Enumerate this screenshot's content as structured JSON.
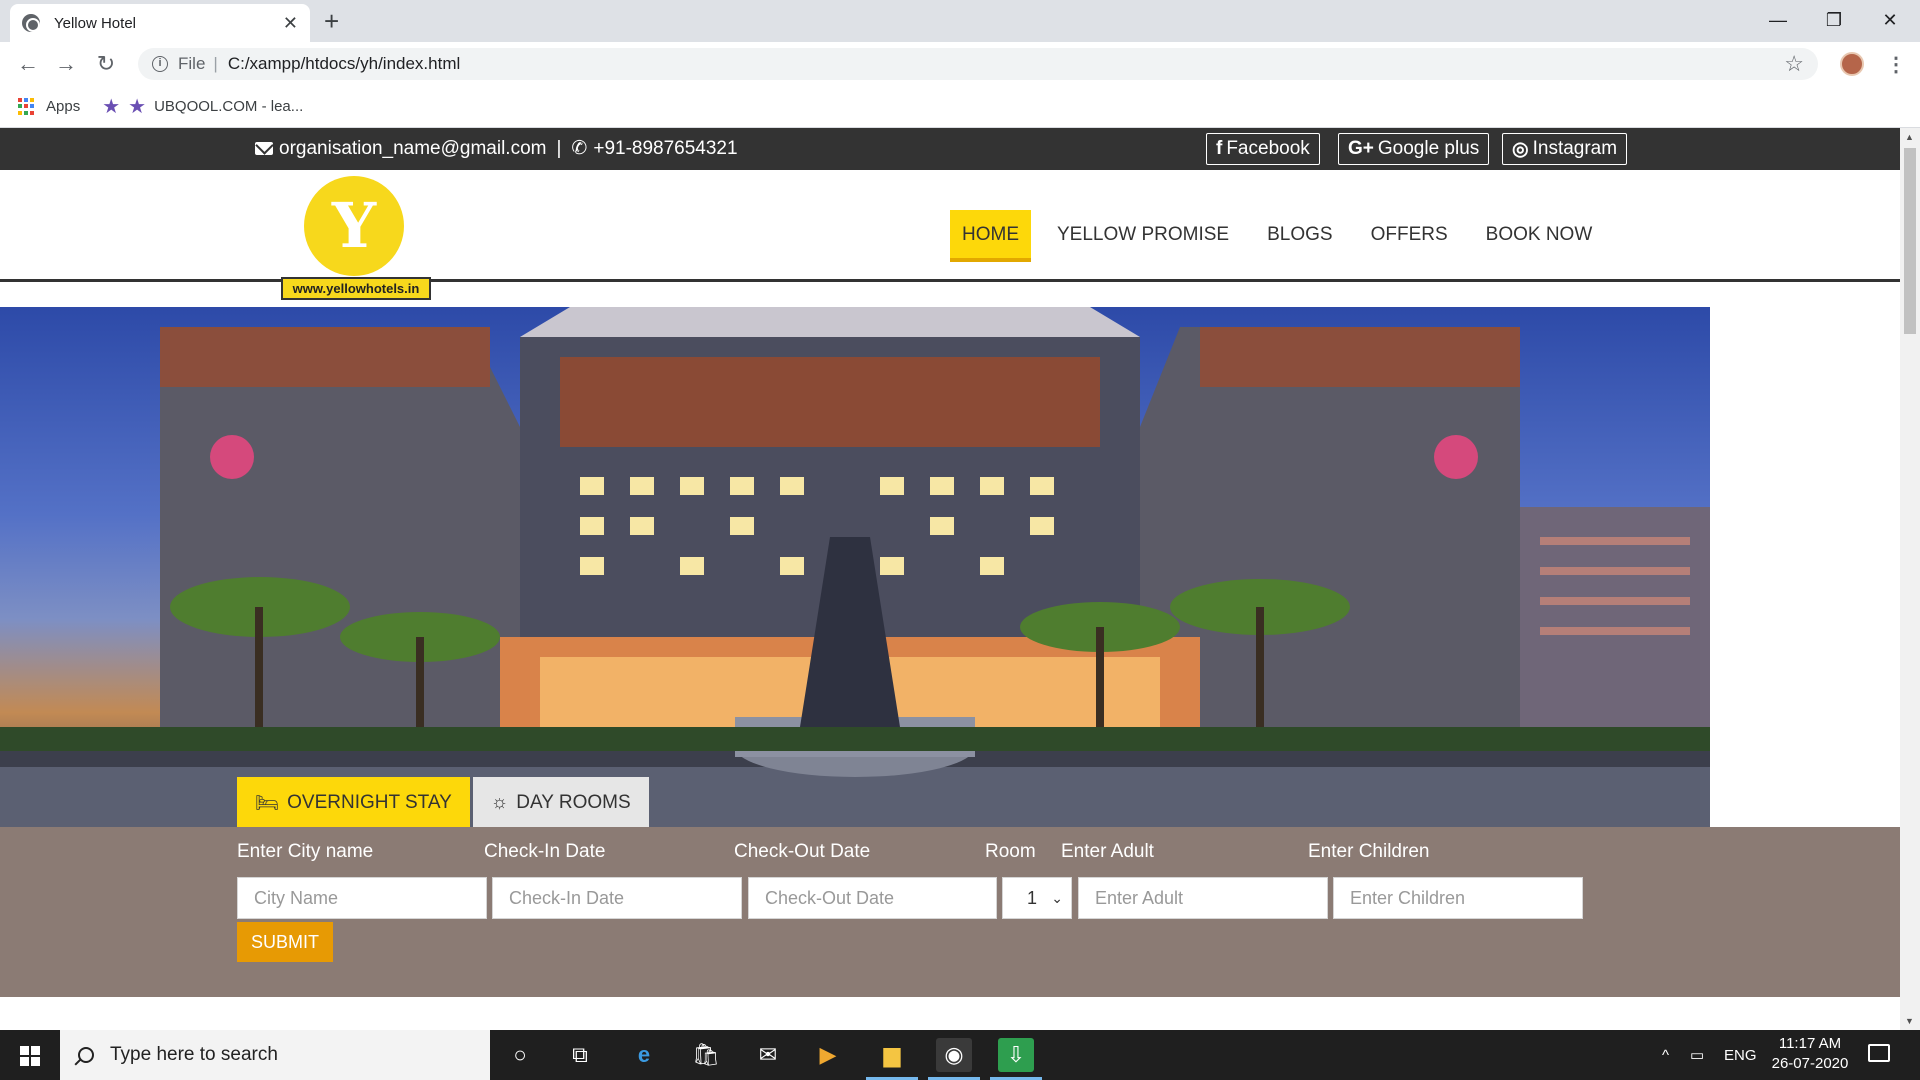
{
  "browser": {
    "tab_title": "Yellow Hotel",
    "tab_close": "✕",
    "new_tab": "+",
    "url_scheme": "File",
    "url_sep": "|",
    "url": "C:/xampp/htdocs/yh/index.html",
    "bookmarks": {
      "apps": "Apps",
      "item": "UBQOOL.COM - lea..."
    },
    "window_controls": {
      "minimize": "—",
      "restore": "❐",
      "close": "✕"
    }
  },
  "topbar": {
    "email": "organisation_name@gmail.com",
    "divider": "|",
    "phone": "+91-8987654321",
    "social": [
      {
        "label": "Facebook",
        "icon": "f"
      },
      {
        "label": "Google plus",
        "icon": "G+"
      },
      {
        "label": "Instagram",
        "icon": "◎"
      }
    ]
  },
  "header": {
    "logo_letter": "Y",
    "logo_url": "www.yellowhotels.in",
    "nav": [
      "HOME",
      "YELLOW PROMISE",
      "BLOGS",
      "OFFERS",
      "BOOK NOW"
    ],
    "active_nav": "HOME"
  },
  "hero": {
    "tabs": [
      {
        "label": "OVERNIGHT STAY",
        "icon": "bed-icon",
        "active": true
      },
      {
        "label": "DAY ROOMS",
        "icon": "sun-icon",
        "active": false
      }
    ]
  },
  "booking": {
    "labels": {
      "city": "Enter City name",
      "checkin": "Check-In Date",
      "checkout": "Check-Out Date",
      "room": "Room",
      "adult": "Enter Adult",
      "children": "Enter Children"
    },
    "placeholders": {
      "city": "City Name",
      "checkin": "Check-In Date",
      "checkout": "Check-Out Date",
      "adult": "Enter Adult",
      "children": "Enter Children"
    },
    "room_value": "1",
    "submit": "SUBMIT"
  },
  "taskbar": {
    "search_placeholder": "Type here to search",
    "lang": "ENG",
    "time": "11:17 AM",
    "date": "26-07-2020"
  },
  "colors": {
    "accent_yellow": "#fdd80a",
    "submit_orange": "#e79a04",
    "booking_bg": "#8b7b74",
    "topbar_bg": "#333333"
  }
}
